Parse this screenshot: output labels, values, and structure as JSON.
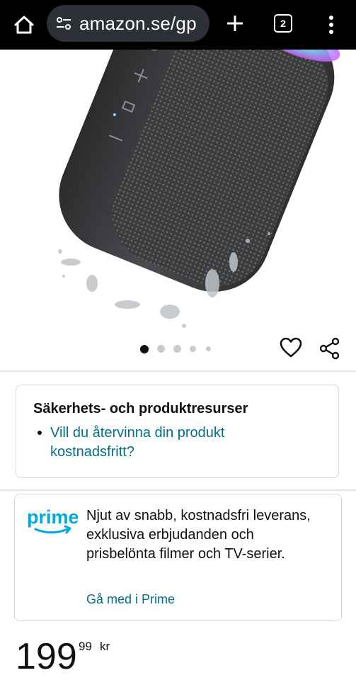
{
  "browser": {
    "url": "amazon.se/gp",
    "tab_count": "2",
    "icons": [
      "home-icon",
      "site-settings-icon",
      "plus-icon",
      "tabs-icon",
      "menu-icon"
    ]
  },
  "product": {
    "carousel": {
      "total": 5,
      "active": 1
    },
    "icons": [
      "heart-icon",
      "share-icon"
    ]
  },
  "safety": {
    "title": "Säkerhets- och produktresurser",
    "link": "Vill du återvinna din produkt kostnadsfritt?"
  },
  "prime": {
    "logo_text": "prime",
    "description": "Njut av snabb, kostnadsfri leverans, exklusiva erbjudanden och prisbelönta filmer och TV-serier.",
    "cta": "Gå med i Prime"
  },
  "price": {
    "whole": "199",
    "fraction": "99",
    "currency": "kr"
  },
  "colors": {
    "link": "#007185",
    "prime_blue": "#00a8e1",
    "text": "#0f1111",
    "browser_bar": "#000000"
  }
}
